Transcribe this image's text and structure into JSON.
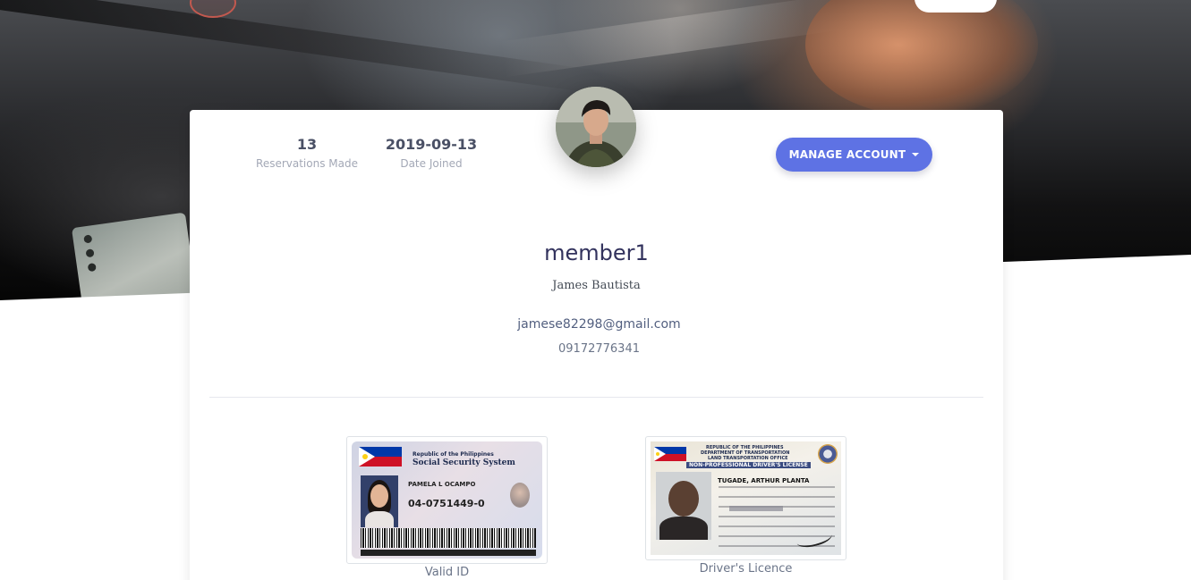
{
  "profile": {
    "username": "member1",
    "full_name": "James Bautista",
    "email": "jamese82298@gmail.com",
    "phone": "09172776341"
  },
  "stats": [
    {
      "value": "13",
      "label": "Reservations Made"
    },
    {
      "value": "2019-09-13",
      "label": "Date Joined"
    }
  ],
  "actions": {
    "manage_account_label": "MANAGE ACCOUNT"
  },
  "documents": [
    {
      "caption": "Valid ID",
      "card_header_small": "Republic of the Philippines",
      "card_header_title": "Social Security System",
      "card_holder": "PAMELA L OCAMPO",
      "card_number": "04-0751449-0"
    },
    {
      "caption": "Driver's Licence",
      "card_line1": "REPUBLIC OF THE PHILIPPINES",
      "card_line2": "DEPARTMENT OF TRANSPORTATION",
      "card_line3": "LAND TRANSPORTATION OFFICE",
      "card_type": "NON-PROFESSIONAL DRIVER'S LICENSE",
      "card_holder": "TUGADE, ARTHUR PLANTA"
    }
  ],
  "colors": {
    "primary": "#5e72e4",
    "heading": "#32325d",
    "muted_text": "#a3a8b6",
    "body_text": "#525f7f"
  },
  "icons": {
    "dropdown": "caret-down-icon",
    "logo": "brand-logo"
  }
}
